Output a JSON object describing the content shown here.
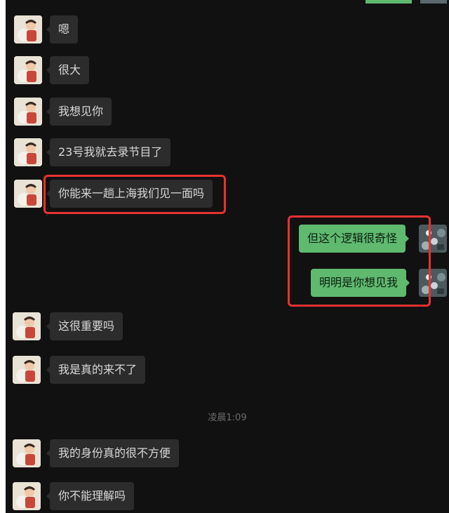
{
  "conversation": {
    "incoming_messages": [
      {
        "text": "嗯"
      },
      {
        "text": "很大"
      },
      {
        "text": "我想见你"
      },
      {
        "text": "23号我就去录节目了"
      },
      {
        "text": "你能来一趟上海我们见一面吗"
      },
      {
        "text": "这很重要吗"
      },
      {
        "text": "我是真的来不了"
      },
      {
        "text": "我的身份真的很不方便"
      },
      {
        "text": "你不能理解吗"
      }
    ],
    "outgoing_messages": [
      {
        "text": "但这个逻辑很奇怪"
      },
      {
        "text": "明明是你想见我"
      }
    ],
    "timestamp": "凌晨1:09"
  },
  "colors": {
    "background": "#111111",
    "incoming_bubble": "#2c2c2c",
    "outgoing_bubble": "#5fb96f",
    "highlight": "#e8322f"
  }
}
